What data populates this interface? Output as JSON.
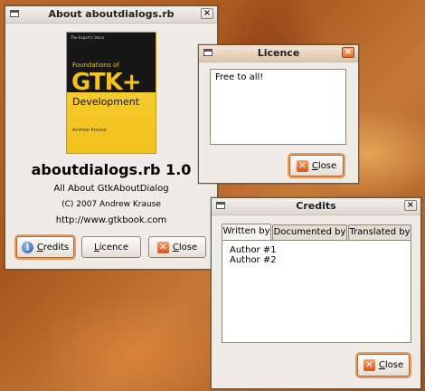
{
  "about": {
    "title": "About aboutdialogs.rb",
    "close_glyph": "×",
    "cover": {
      "series": "The Expert's Voice",
      "foundations": "Foundations of",
      "gtk": "GTK+",
      "development": "Development",
      "author": "Andrew Krause"
    },
    "program_name": "aboutdialogs.rb 1.0",
    "comments": "All About GtkAboutDialog",
    "copyright": "(C) 2007 Andrew Krause",
    "website": "http://www.gtkbook.com",
    "buttons": {
      "credits": {
        "mnemonic": "C",
        "rest": "redits",
        "icon": "info-icon"
      },
      "licence": {
        "mnemonic": "L",
        "rest": "icence"
      },
      "close": {
        "mnemonic": "C",
        "rest": "lose",
        "icon": "close-icon"
      }
    }
  },
  "licence": {
    "title": "Licence",
    "close_glyph": "×",
    "text": "Free to all!",
    "close_button": {
      "mnemonic": "C",
      "rest": "lose"
    }
  },
  "credits": {
    "title": "Credits",
    "close_glyph": "×",
    "tabs": [
      "Written by",
      "Documented by",
      "Translated by"
    ],
    "active_tab": 0,
    "authors": [
      "Author #1",
      "Author #2"
    ],
    "close_button": {
      "mnemonic": "C",
      "rest": "lose"
    }
  }
}
